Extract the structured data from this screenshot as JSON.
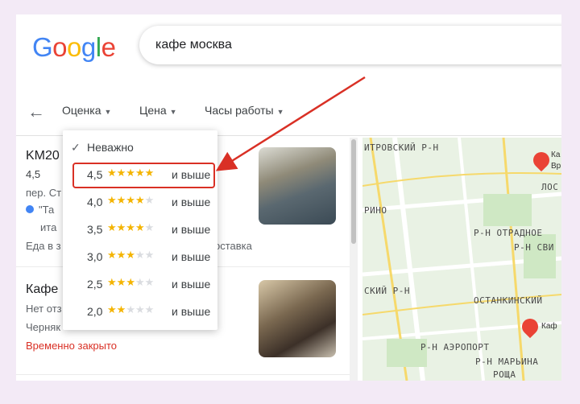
{
  "search": {
    "query": "кафе москва"
  },
  "filters": {
    "rating": "Оценка",
    "price": "Цена",
    "hours": "Часы работы"
  },
  "dropdown": {
    "any": "Неважно",
    "options": [
      {
        "value": "4,5",
        "rating": 4.5,
        "suffix": "и выше"
      },
      {
        "value": "4,0",
        "rating": 4.0,
        "suffix": "и выше"
      },
      {
        "value": "3,5",
        "rating": 3.5,
        "suffix": "и выше"
      },
      {
        "value": "3,0",
        "rating": 3.0,
        "suffix": "и выше"
      },
      {
        "value": "2,5",
        "rating": 2.5,
        "suffix": "и выше"
      },
      {
        "value": "2,0",
        "rating": 2.0,
        "suffix": "и выше"
      }
    ]
  },
  "results": [
    {
      "title": "KM20",
      "rating": "4,5",
      "line2": "пер. Ст",
      "line3": "\"Та",
      "line3b": "ита",
      "line4": "Еда в з",
      "line4b": "оставка"
    },
    {
      "title": "Кафе",
      "line2": "Нет отз",
      "line3": "Черняк",
      "status": "Временно закрыто"
    }
  ],
  "map": {
    "labels": [
      "ИТРОВСКИЙ Р-Н",
      "РИНО",
      "Р-Н ОТРАДНОЕ",
      "Р-Н СВИ",
      "СКИЙ Р-Н",
      "ОСТАНКИНСКИЙ",
      "Р-Н АЭРОПОРТ",
      "Р-Н МАРЬИНА",
      "РОЩА",
      "ЛОС"
    ],
    "pins": [
      "Ка",
      "Вр",
      "Каф"
    ]
  },
  "colors": {
    "accent_red": "#d93025",
    "star": "#f4b400"
  }
}
